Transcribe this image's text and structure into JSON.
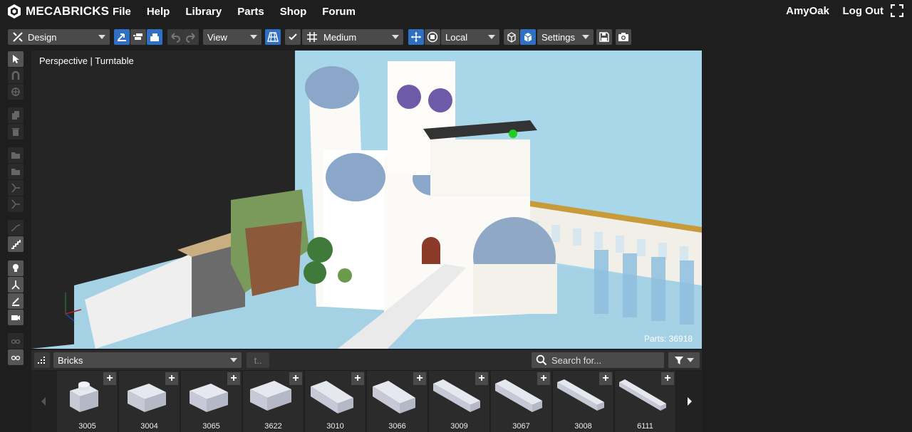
{
  "app": {
    "name": "MECABRICKS"
  },
  "menu": [
    "File",
    "Help",
    "Library",
    "Parts",
    "Shop",
    "Forum"
  ],
  "user": {
    "name": "AmyOak",
    "logout": "Log Out"
  },
  "toolbar": {
    "mode": "Design",
    "view": "View",
    "quality": "Medium",
    "space": "Local",
    "settings": "Settings"
  },
  "viewport": {
    "label": "Perspective | Turntable",
    "parts": "Parts: 36918"
  },
  "library": {
    "category": "Bricks",
    "up": "t..",
    "search_placeholder": "Search for...",
    "bricks": [
      {
        "id": "3005"
      },
      {
        "id": "3004"
      },
      {
        "id": "3065"
      },
      {
        "id": "3622"
      },
      {
        "id": "3010"
      },
      {
        "id": "3066"
      },
      {
        "id": "3009"
      },
      {
        "id": "3067"
      },
      {
        "id": "3008"
      },
      {
        "id": "6111"
      }
    ]
  },
  "colors": {
    "accent": "#2f6fc4",
    "sky": "#a9d7ea",
    "brick": "#c9ccd8"
  }
}
